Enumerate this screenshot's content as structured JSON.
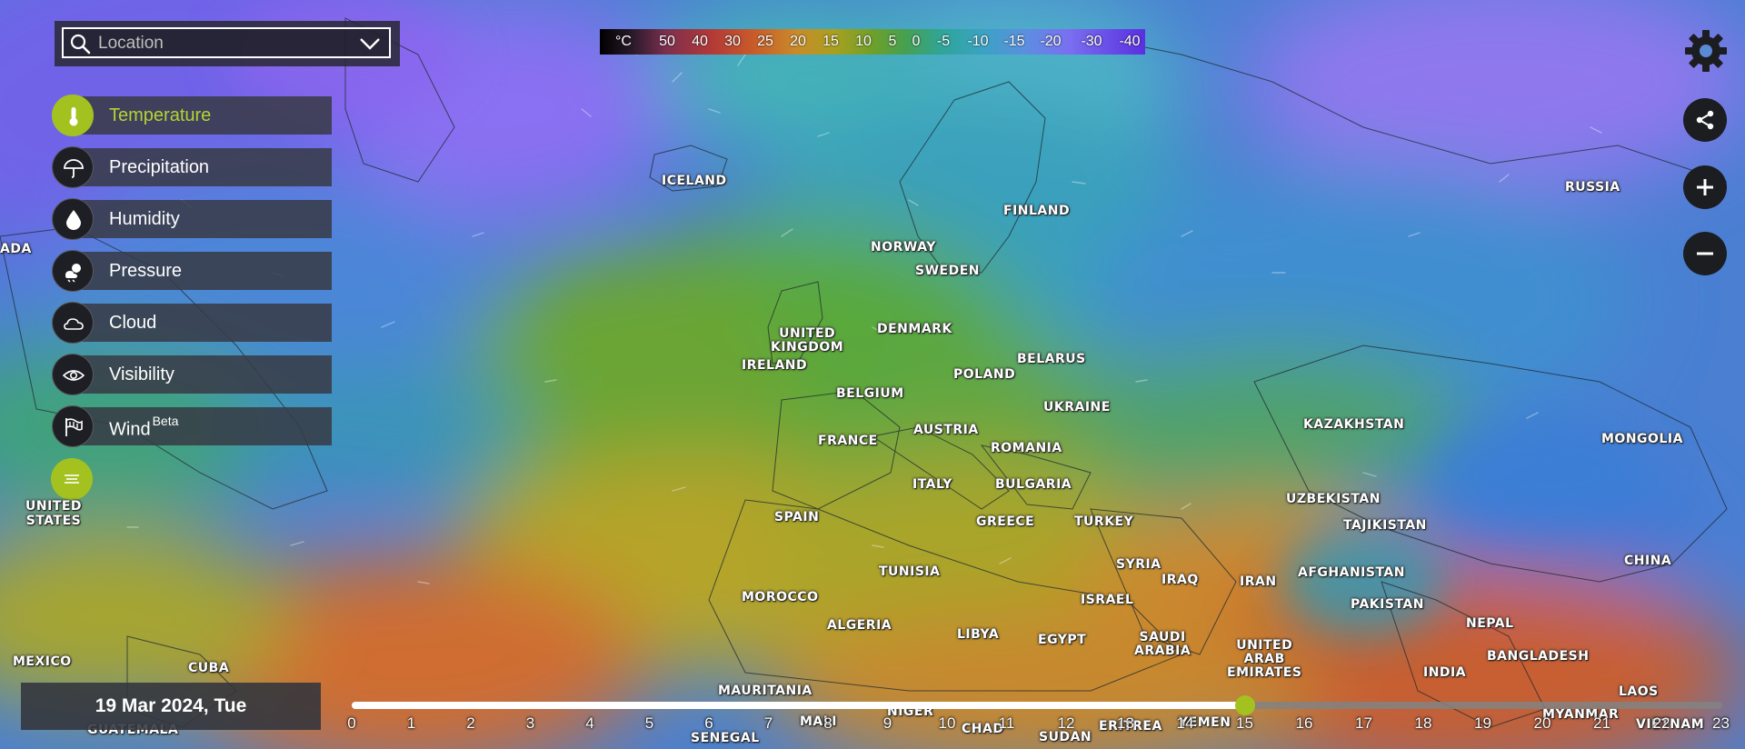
{
  "search": {
    "placeholder": "Location"
  },
  "legend": {
    "unit": "°C",
    "values": [
      "50",
      "40",
      "30",
      "25",
      "20",
      "15",
      "10",
      "5",
      "0",
      "-5",
      "-10",
      "-15",
      "-20",
      "-30",
      "-40"
    ]
  },
  "layers": [
    {
      "label": "Temperature",
      "icon": "thermometer-icon",
      "active": true
    },
    {
      "label": "Precipitation",
      "icon": "umbrella-icon",
      "active": false
    },
    {
      "label": "Humidity",
      "icon": "droplet-icon",
      "active": false
    },
    {
      "label": "Pressure",
      "icon": "pressure-icon",
      "active": false
    },
    {
      "label": "Cloud",
      "icon": "cloud-icon",
      "active": false
    },
    {
      "label": "Visibility",
      "icon": "eye-icon",
      "active": false
    },
    {
      "label": "Wind",
      "sup": "Beta",
      "icon": "wind-flag-icon",
      "active": false
    }
  ],
  "countries": [
    {
      "name": "ICELAND"
    },
    {
      "name": "FINLAND"
    },
    {
      "name": "NORWAY"
    },
    {
      "name": "SWEDEN"
    },
    {
      "name": "DENMARK"
    },
    {
      "name": "UNITED\nKINGDOM"
    },
    {
      "name": "IRELAND"
    },
    {
      "name": "POLAND"
    },
    {
      "name": "BELARUS"
    },
    {
      "name": "BELGIUM"
    },
    {
      "name": "UKRAINE"
    },
    {
      "name": "FRANCE"
    },
    {
      "name": "AUSTRIA"
    },
    {
      "name": "ROMANIA"
    },
    {
      "name": "ITALY"
    },
    {
      "name": "BULGARIA"
    },
    {
      "name": "SPAIN"
    },
    {
      "name": "GREECE"
    },
    {
      "name": "TURKEY"
    },
    {
      "name": "TUNISIA"
    },
    {
      "name": "SYRIA"
    },
    {
      "name": "IRAQ"
    },
    {
      "name": "IRAN"
    },
    {
      "name": "ISRAEL"
    },
    {
      "name": "MOROCCO"
    },
    {
      "name": "ALGERIA"
    },
    {
      "name": "LIBYA"
    },
    {
      "name": "EGYPT"
    },
    {
      "name": "SAUDI\nARABIA"
    },
    {
      "name": "UNITED\nARAB\nEMIRATES"
    },
    {
      "name": "MAURITANIA"
    },
    {
      "name": "MALI"
    },
    {
      "name": "NIGER"
    },
    {
      "name": "CHAD"
    },
    {
      "name": "SUDAN"
    },
    {
      "name": "ERITREA"
    },
    {
      "name": "YEMEN"
    },
    {
      "name": "SENEGAL"
    },
    {
      "name": "RUSSIA"
    },
    {
      "name": "KAZAKHSTAN"
    },
    {
      "name": "MONGOLIA"
    },
    {
      "name": "UZBEKISTAN"
    },
    {
      "name": "TAJIKISTAN"
    },
    {
      "name": "AFGHANISTAN"
    },
    {
      "name": "PAKISTAN"
    },
    {
      "name": "CHINA"
    },
    {
      "name": "NEPAL"
    },
    {
      "name": "INDIA"
    },
    {
      "name": "BANGLADESH"
    },
    {
      "name": "MYANMAR"
    },
    {
      "name": "LAOS"
    },
    {
      "name": "VIETNAM"
    },
    {
      "name": "MEXICO"
    },
    {
      "name": "CUBA"
    },
    {
      "name": "GUATEMALA"
    },
    {
      "name": "ADA"
    }
  ],
  "us_label": "UNITED\nSTATES",
  "date": "19 Mar 2024, Tue",
  "timeline": {
    "hours": [
      "0",
      "1",
      "2",
      "3",
      "4",
      "5",
      "6",
      "7",
      "8",
      "9",
      "10",
      "11",
      "12",
      "13",
      "14",
      "15",
      "16",
      "17",
      "18",
      "19",
      "20",
      "21",
      "22",
      "23"
    ],
    "current_hour": 15
  },
  "colors": {
    "accent": "#a3c21f",
    "panel": "#373a44"
  }
}
